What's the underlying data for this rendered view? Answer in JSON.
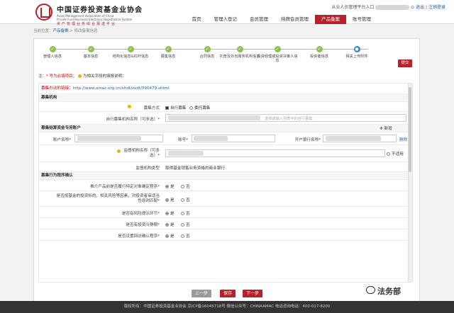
{
  "header": {
    "logo_cn": "中国证券投资基金业协会",
    "logo_en1": "Asset Management Association of China",
    "logo_en2": "Private Fund Business Electronic Registration System",
    "logo_sub": "资产管理业务综合报送平台",
    "user_prefix": "从业人员管理平台入口",
    "logout": "退出",
    "change_pwd": "注销登录",
    "nav": [
      "首页",
      "管理人登记",
      "会员管理",
      "持牌会员管理",
      "产品备案",
      "账号管理"
    ],
    "active_nav": "产品备案"
  },
  "breadcrumb": {
    "prefix": "当前位置：",
    "item1": "产品备案",
    "sep": " > ",
    "item2": "修改备案信息"
  },
  "steps": [
    {
      "label": "管理人信息"
    },
    {
      "label": "基本信息"
    },
    {
      "label": "结构化信息&杠杆信息"
    },
    {
      "label": "募集信息"
    },
    {
      "label": "合同信息"
    },
    {
      "label": "托管及外包服务机构信息"
    },
    {
      "label": "投资经理或投资决策人信息"
    },
    {
      "label": "投资者信息"
    },
    {
      "label": "相关上传附件"
    }
  ],
  "submit_top": "提交",
  "note": {
    "required": "注：* 号为必填项目；",
    "help": "为相关字段的填报说明："
  },
  "form": {
    "link_label": "募集办法的链接：",
    "link_url": "http://www.amac.org.cn/xhdt/zxdt/390479.shtml",
    "sec1": "募集机构",
    "raise_mode_label": "募集方式",
    "raise_self": "自行募集",
    "raise_entrust": "委托募集",
    "self_name_label": "自行募集机构名称（可多选）",
    "self_name_ph": "选择或输入列表中的自行募集",
    "sec2": "募集结算资金专用账户",
    "acct_name_label": "账户名称",
    "acct_no_label": "账号",
    "bank_label": "开户银行名称",
    "add_btn": "新增",
    "del_btn": "删除",
    "supervisor_label": "监督机构名称（可多选）",
    "not_apply": "不适用",
    "supervisor_type_label": "监督机构类型",
    "supervisor_type_value": "取得基金销售业务资格的商业银行",
    "sec3": "募集行为程序确认",
    "q1": "推介产品前是否履行特定对象确定程序",
    "q2": "是否按基金的投资标的、相关风险等因素，对投资者审适当性原则匹配",
    "q3": "是否有风险提示环节",
    "q4": "是否有投资冷静期",
    "q5": "是否设置回访确认程序",
    "yes": "是",
    "no": "否"
  },
  "buttons": {
    "prev": "上一步",
    "save": "保存",
    "next": "下一步"
  },
  "footer": "版权所有：中国证券投资基金业协会    京ICP备16045718号    微信公众号：CHINAAMAC    电话咨询电话：400-017-8200",
  "watermark": "法务部",
  "colors": {
    "brand": "#b8212a",
    "step_done": "#8cc152",
    "step_current": "#3b82c4"
  }
}
